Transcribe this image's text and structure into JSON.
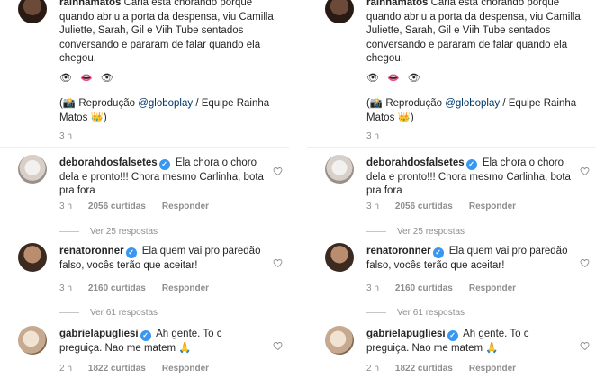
{
  "post": {
    "username": "rainhamatos",
    "caption": "Carla está chorando porque quando abriu a porta da despensa, viu Camilla, Juliette, Sarah, Gil e Viih Tube sentados conversando e pararam de falar quando ela chegou.",
    "emojis": "👁 👄 👁",
    "credit_prefix": "(📸 Reprodução ",
    "credit_tag": "@globoplay",
    "credit_suffix": " / Equipe Rainha Matos 👑)",
    "time": "3 h"
  },
  "comments": [
    {
      "username": "deborahdosfalsetes",
      "text": "Ela chora o choro dela e pronto!!! Chora mesmo Carlinha, bota pra fora",
      "time": "3 h",
      "likes": "2056 curtidas",
      "reply": "Responder",
      "view_replies": "Ver 25 respostas"
    },
    {
      "username": "renatoronner",
      "text": "Ela quem vai pro paredão falso, vocês terão que aceitar!",
      "time": "3 h",
      "likes": "2160 curtidas",
      "reply": "Responder",
      "view_replies": "Ver 61 respostas"
    },
    {
      "username": "gabrielapugliesi",
      "text": "Ah gente. To c preguiça. Nao me matem 🙏",
      "time": "2 h",
      "likes": "1822 curtidas",
      "reply": "Responder",
      "view_replies": ""
    }
  ],
  "colors": {
    "verified": "#3897f0",
    "muted": "#8e8e8e",
    "link": "#00376b"
  }
}
